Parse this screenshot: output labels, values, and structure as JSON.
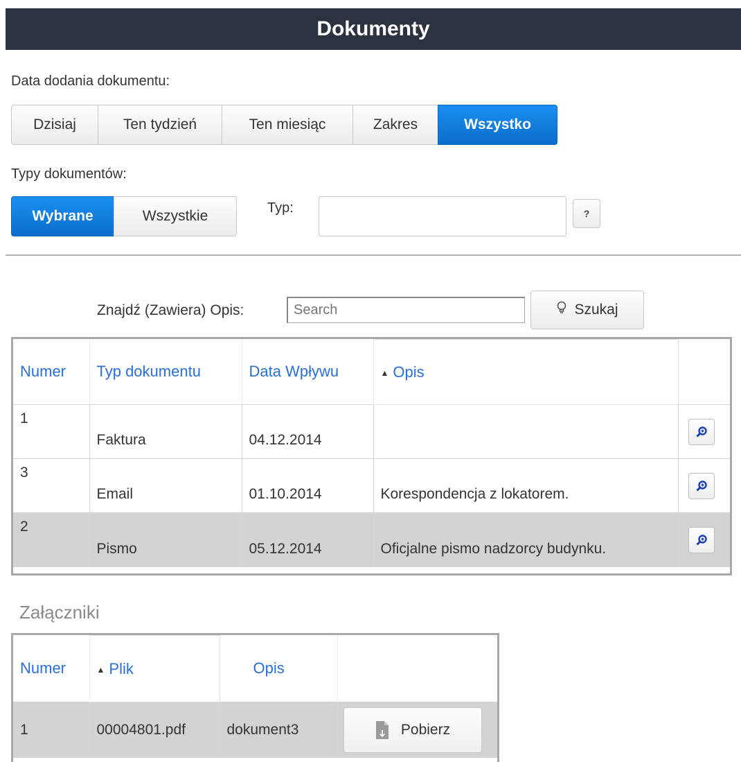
{
  "header": {
    "title": "Dokumenty"
  },
  "date_filter": {
    "label": "Data dodania dokumentu:",
    "options": [
      "Dzisiaj",
      "Ten tydzień",
      "Ten miesiąc",
      "Zakres",
      "Wszystko"
    ],
    "active": "Wszystko"
  },
  "type_filter": {
    "label": "Typy dokumentów:",
    "options": [
      "Wybrane",
      "Wszystkie"
    ],
    "active": "Wybrane",
    "typ_label": "Typ:",
    "typ_value": "",
    "help_label": "?"
  },
  "search": {
    "label": "Znajdź (Zawiera) Opis:",
    "placeholder": "Search",
    "button_label": "Szukaj"
  },
  "documents": {
    "columns": [
      "Numer",
      "Typ dokumentu",
      "Data Wpływu",
      "Opis"
    ],
    "sort_arrow": "▲",
    "rows": [
      {
        "numer": "1",
        "typ": "Faktura",
        "data": "04.12.2014",
        "opis": ""
      },
      {
        "numer": "3",
        "typ": "Email",
        "data": "01.10.2014",
        "opis": "Korespondencja z lokatorem."
      },
      {
        "numer": "2",
        "typ": "Pismo",
        "data": "05.12.2014",
        "opis": "Oficjalne pismo nadzorcy budynku."
      }
    ],
    "selected_row": 2
  },
  "attachments": {
    "title": "Załączniki",
    "columns": [
      "Numer",
      "Plik",
      "Opis"
    ],
    "sort_arrow": "▲",
    "rows": [
      {
        "numer": "1",
        "plik": "00004801.pdf",
        "opis": "dokument3",
        "button_label": "Pobierz"
      }
    ]
  },
  "icons": {
    "search_button_icon": "lightbulb-icon",
    "row_action_icon": "magnifier-icon",
    "download_icon": "file-download-icon"
  },
  "colors": {
    "header_bg": "#2b3240",
    "active_button": "#1a7fe0",
    "link_blue": "#2a6fd6",
    "selected_row": "#d3d3d3"
  }
}
